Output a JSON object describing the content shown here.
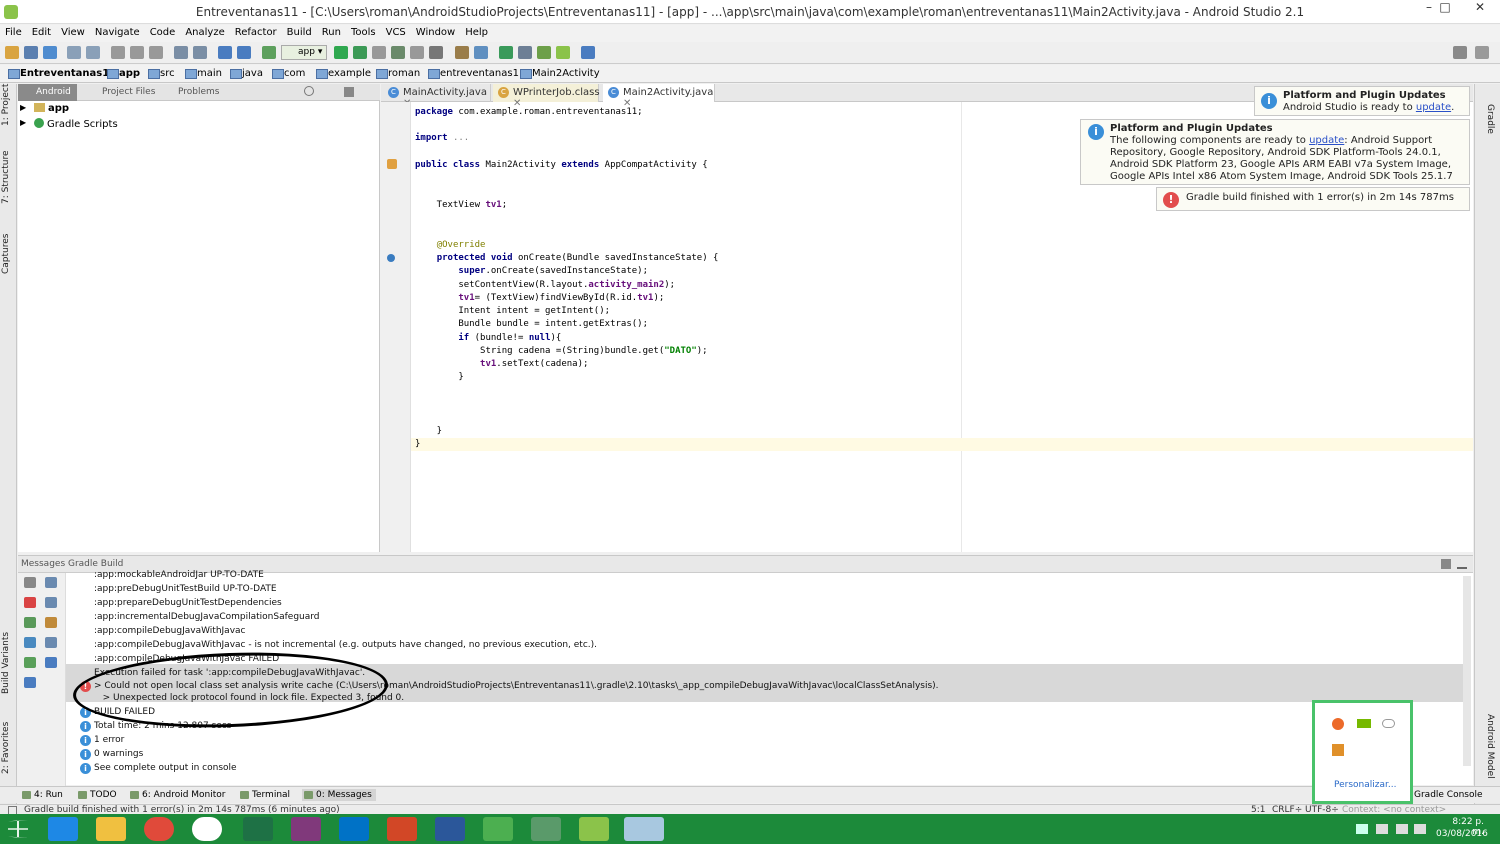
{
  "window": {
    "title": "Entreventanas11 - [C:\\Users\\roman\\AndroidStudioProjects\\Entreventanas11] - [app] - ...\\app\\src\\main\\java\\com\\example\\roman\\entreventanas11\\Main2Activity.java - Android Studio 2.1",
    "minimize": "–",
    "maximize": "□",
    "close": "✕"
  },
  "menu": [
    "File",
    "Edit",
    "View",
    "Navigate",
    "Code",
    "Analyze",
    "Refactor",
    "Build",
    "Run",
    "Tools",
    "VCS",
    "Window",
    "Help"
  ],
  "toolbar": {
    "run_config": "app"
  },
  "breadcrumbs": [
    "Entreventanas11",
    "app",
    "src",
    "main",
    "java",
    "com",
    "example",
    "roman",
    "entreventanas11",
    "Main2Activity"
  ],
  "left_strip": {
    "project": "1: Project",
    "structure": "7: Structure",
    "captures": "Captures",
    "build_variants": "Build Variants",
    "favorites": "2: Favorites"
  },
  "right_strip": {
    "gradle": "Gradle",
    "android_model": "Android Model"
  },
  "project_panel": {
    "tabs": [
      "Android",
      "Project Files",
      "Problems"
    ],
    "tree": [
      {
        "label": "app"
      },
      {
        "label": "Gradle Scripts"
      }
    ]
  },
  "editor": {
    "tabs": [
      {
        "label": "MainActivity.java"
      },
      {
        "label": "WPrinterJob.class"
      },
      {
        "label": "Main2Activity.java"
      }
    ]
  },
  "notifications": {
    "n1": {
      "title": "Platform and Plugin Updates",
      "body": "Android Studio is ready to ",
      "link": "update",
      "tail": "."
    },
    "n2": {
      "title": "Platform and Plugin Updates",
      "body_pre": "The following components are ready to ",
      "link": "update",
      "body_post": ": Android Support Repository, Google Repository, Android SDK Platform-Tools 24.0.1, Android SDK Platform 23, Google APIs ARM EABI v7a System Image, Google APIs Intel x86 Atom System Image, Android SDK Tools 25.1.7"
    },
    "n3": {
      "text": "Gradle build finished with 1 error(s) in 2m 14s 787ms"
    }
  },
  "messages": {
    "header": "Messages Gradle Build",
    "lines": [
      ":app:mockableAndroidJar UP-TO-DATE",
      ":app:preDebugUnitTestBuild UP-TO-DATE",
      ":app:prepareDebugUnitTestDependencies",
      ":app:incrementalDebugJavaCompilationSafeguard",
      ":app:compileDebugJavaWithJavac",
      ":app:compileDebugJavaWithJavac - is not incremental (e.g. outputs have changed, no previous execution, etc.).",
      ":app:compileDebugJavaWithJavac FAILED"
    ],
    "error": [
      "Execution failed for task ':app:compileDebugJavaWithJavac'.",
      "> Could not open local class set analysis write cache (C:\\Users\\roman\\AndroidStudioProjects\\Entreventanas11\\.gradle\\2.10\\tasks\\_app_compileDebugJavaWithJavac\\localClassSetAnalysis).",
      "   > Unexpected lock protocol found in lock file. Expected 3, found 0."
    ],
    "info": [
      "BUILD FAILED",
      "Total time: 2 mins 12.807 secs",
      "1 error",
      "0 warnings",
      "See complete output in console"
    ]
  },
  "bottom_tabs": [
    "4: Run",
    "TODO",
    "6: Android Monitor",
    "Terminal",
    "0: Messages",
    "Gradle Console"
  ],
  "status": {
    "left": "Gradle build finished with 1 error(s) in 2m 14s 787ms (6 minutes ago)",
    "pos": "5:1",
    "crlf": "CRLF÷",
    "enc": "UTF-8÷",
    "context": "Context: <no context>"
  },
  "tray_popup": {
    "link": "Personalizar..."
  },
  "clock": {
    "time": "8:22 p. m.",
    "date": "03/08/2016"
  }
}
